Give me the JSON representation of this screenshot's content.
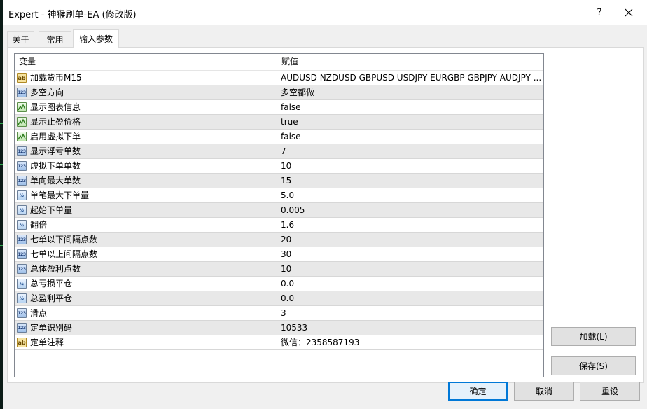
{
  "window": {
    "title": "Expert - 神猴刷单-EA (修改版)",
    "help_label": "?",
    "close_icon": "close-icon"
  },
  "tabs": [
    {
      "label": "关于",
      "active": false
    },
    {
      "label": "常用",
      "active": false
    },
    {
      "label": "输入参数",
      "active": true
    }
  ],
  "grid": {
    "columns": [
      "变量",
      "赋值"
    ],
    "rows": [
      {
        "type": "string",
        "icon_text": "ab",
        "name": "加载货币M15",
        "value": "AUDUSD NZDUSD GBPUSD USDJPY EURGBP GBPJPY AUDJPY ..."
      },
      {
        "type": "int",
        "icon_text": "123",
        "name": "多空方向",
        "value": "多空都做"
      },
      {
        "type": "bool",
        "icon_text": "",
        "name": "显示图表信息",
        "value": "false"
      },
      {
        "type": "bool",
        "icon_text": "",
        "name": "显示止盈价格",
        "value": "true"
      },
      {
        "type": "bool",
        "icon_text": "",
        "name": "启用虚拟下单",
        "value": "false"
      },
      {
        "type": "int",
        "icon_text": "123",
        "name": "显示浮亏单数",
        "value": "7"
      },
      {
        "type": "int",
        "icon_text": "123",
        "name": "虚拟下单单数",
        "value": "10"
      },
      {
        "type": "int",
        "icon_text": "123",
        "name": "单向最大单数",
        "value": "15"
      },
      {
        "type": "double",
        "icon_text": "½",
        "name": "单笔最大下单量",
        "value": "5.0"
      },
      {
        "type": "double",
        "icon_text": "½",
        "name": "起始下单量",
        "value": "0.005"
      },
      {
        "type": "double",
        "icon_text": "½",
        "name": "翻倍",
        "value": "1.6"
      },
      {
        "type": "int",
        "icon_text": "123",
        "name": "七单以下间隔点数",
        "value": "20"
      },
      {
        "type": "int",
        "icon_text": "123",
        "name": "七单以上间隔点数",
        "value": "30"
      },
      {
        "type": "int",
        "icon_text": "123",
        "name": "总体盈利点数",
        "value": "10"
      },
      {
        "type": "double",
        "icon_text": "½",
        "name": "总亏损平仓",
        "value": "0.0"
      },
      {
        "type": "double",
        "icon_text": "½",
        "name": "总盈利平仓",
        "value": "0.0"
      },
      {
        "type": "int",
        "icon_text": "123",
        "name": "滑点",
        "value": "3"
      },
      {
        "type": "int",
        "icon_text": "123",
        "name": "定单识别码",
        "value": "10533"
      },
      {
        "type": "string",
        "icon_text": "ab",
        "name": "定单注释",
        "value": "微信：2358587193"
      }
    ]
  },
  "side_buttons": {
    "load": "加载(L)",
    "save": "保存(S)"
  },
  "footer_buttons": {
    "ok": "确定",
    "cancel": "取消",
    "reset": "重设"
  }
}
